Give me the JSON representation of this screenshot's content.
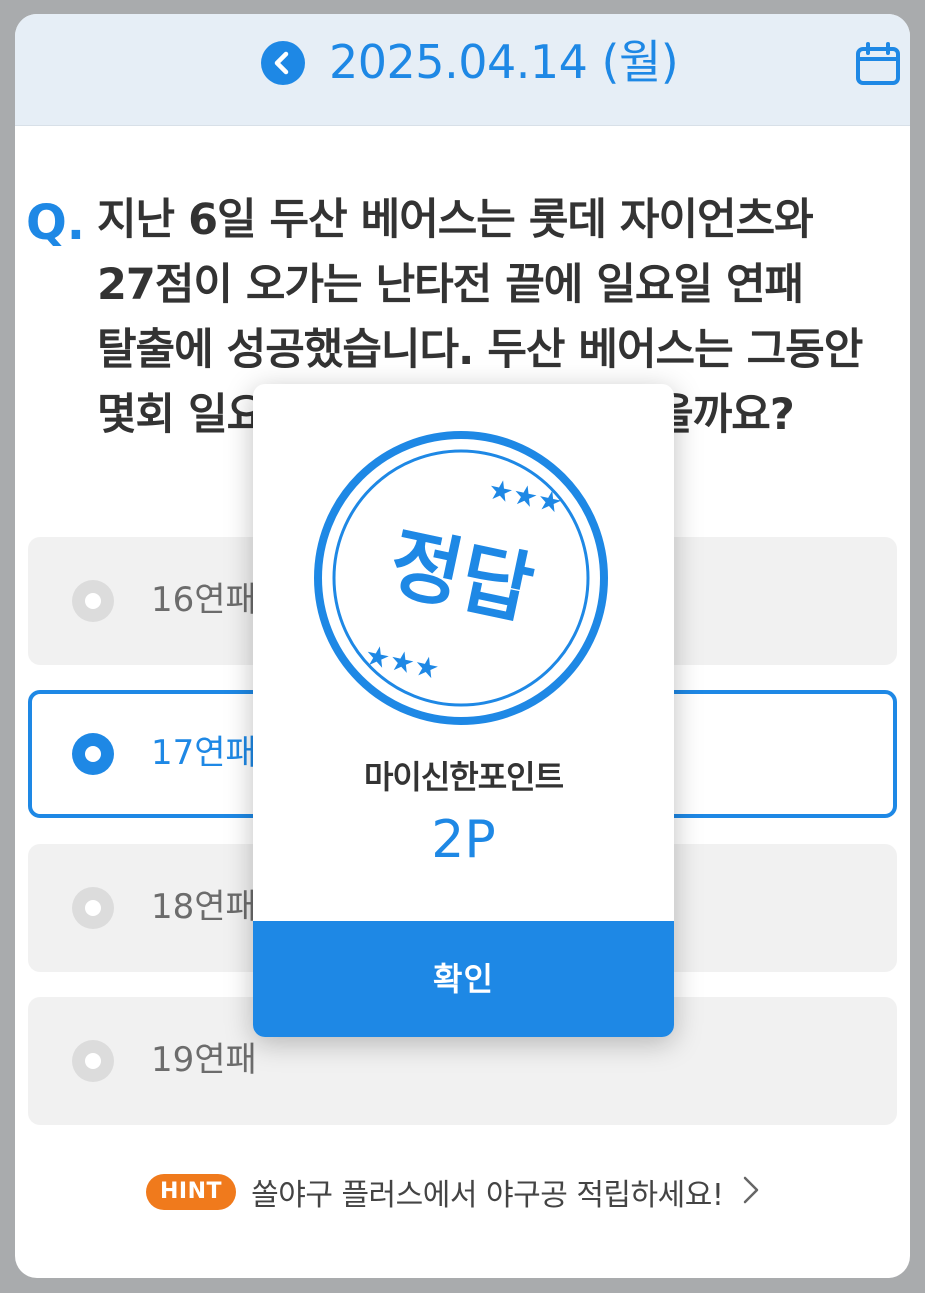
{
  "header": {
    "date": "2025.04.14 (월)",
    "back_icon": "chevron-left-circle-icon",
    "calendar_icon": "calendar-icon"
  },
  "quiz": {
    "question_mark": "Q.",
    "question": "지난 6일 두산 베어스는 롯데 자이언츠와 27점이 오가는 난타전 끝에 일요일 연패 탈출에 성공했습니다. 두산 베어스는 그동안 몇회 일요일 연패를 기록 중이었을까요?",
    "options": [
      {
        "label": "16연패",
        "selected": false
      },
      {
        "label": "17연패",
        "selected": true
      },
      {
        "label": "18연패",
        "selected": false
      },
      {
        "label": "19연패",
        "selected": false
      }
    ]
  },
  "hint": {
    "badge": "HINT",
    "text": "쏠야구 플러스에서 야구공 적립하세요!"
  },
  "modal": {
    "stamp_text": "정답",
    "point_label": "마이신한포인트",
    "point_value": "2P",
    "confirm_label": "확인"
  },
  "colors": {
    "accent": "#1e88e5",
    "hint_badge": "#f07a1c",
    "header_bg": "#e6eef6"
  }
}
